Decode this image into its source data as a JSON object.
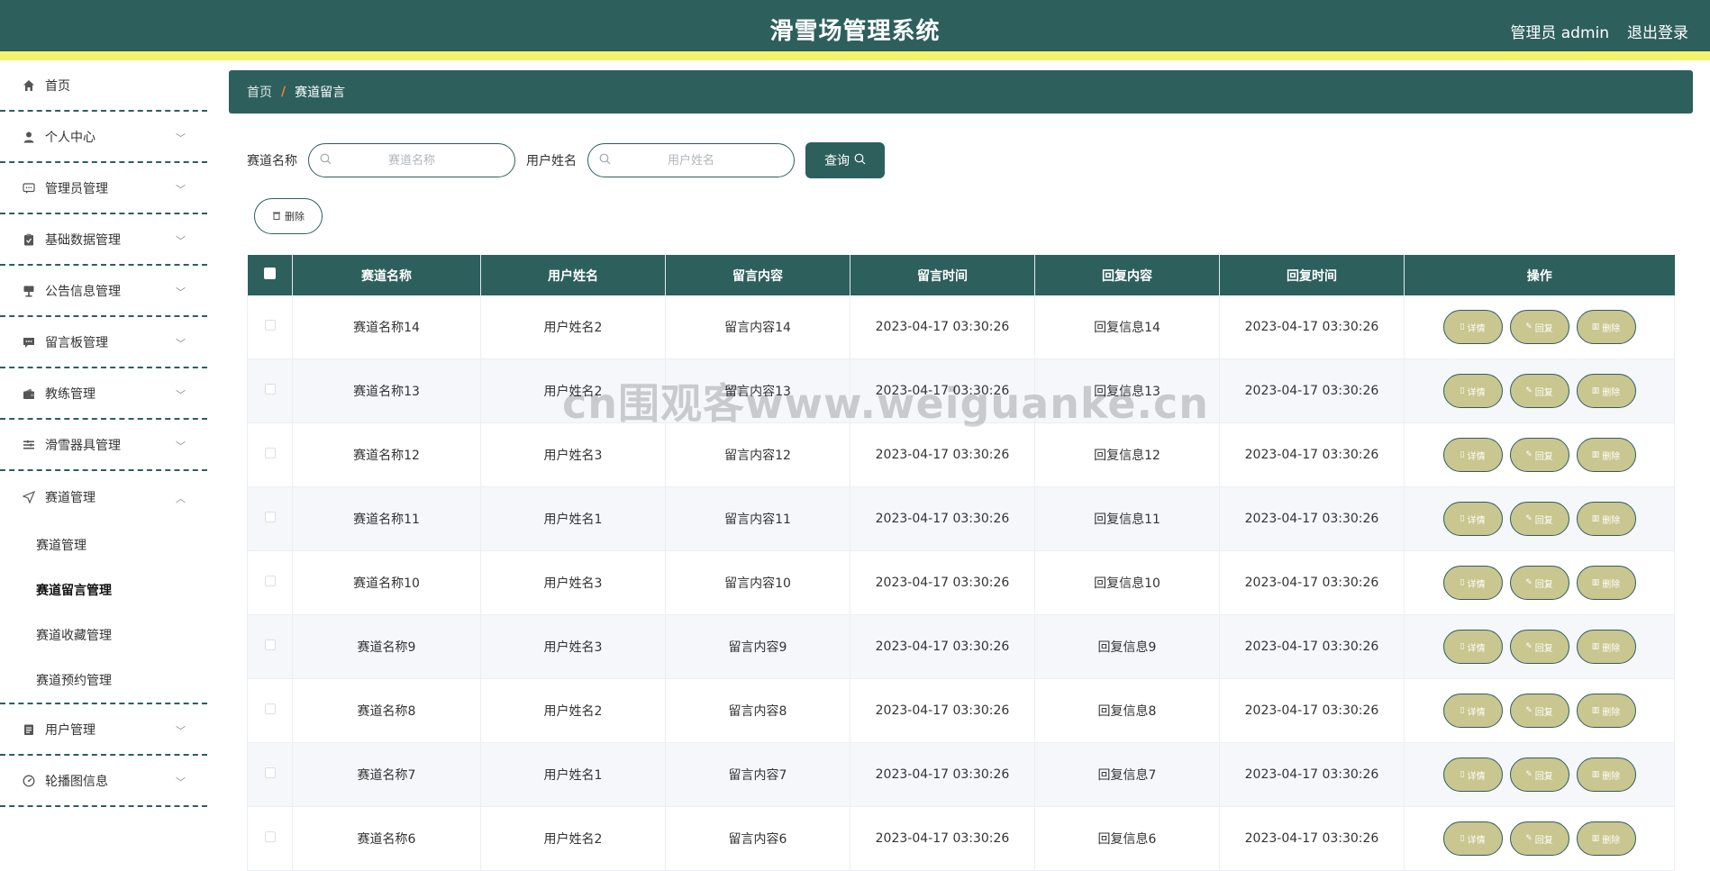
{
  "header": {
    "title": "滑雪场管理系统",
    "user_label": "管理员 admin",
    "logout_label": "退出登录"
  },
  "sidebar": {
    "items": [
      {
        "label": "首页",
        "icon": "home-icon"
      },
      {
        "label": "个人中心",
        "icon": "user-icon"
      },
      {
        "label": "管理员管理",
        "icon": "chat-icon"
      },
      {
        "label": "基础数据管理",
        "icon": "clipboard-icon"
      },
      {
        "label": "公告信息管理",
        "icon": "sign-icon"
      },
      {
        "label": "留言板管理",
        "icon": "message-icon"
      },
      {
        "label": "教练管理",
        "icon": "wallet-icon"
      },
      {
        "label": "滑雪器具管理",
        "icon": "list-icon"
      },
      {
        "label": "赛道管理",
        "icon": "send-icon"
      }
    ],
    "submenu": [
      {
        "label": "赛道管理"
      },
      {
        "label": "赛道留言管理"
      },
      {
        "label": "赛道收藏管理"
      },
      {
        "label": "赛道预约管理"
      }
    ],
    "items_after": [
      {
        "label": "用户管理",
        "icon": "doc-icon"
      },
      {
        "label": "轮播图信息",
        "icon": "gauge-icon"
      }
    ]
  },
  "breadcrumb": {
    "home": "首页",
    "sep": "/",
    "current": "赛道留言"
  },
  "search": {
    "track_label": "赛道名称",
    "track_placeholder": "赛道名称",
    "user_label": "用户姓名",
    "user_placeholder": "用户姓名",
    "query_label": "查询"
  },
  "toolbar": {
    "delete_label": "删除"
  },
  "table": {
    "columns": [
      "赛道名称",
      "用户姓名",
      "留言内容",
      "留言时间",
      "回复内容",
      "回复时间",
      "操作"
    ],
    "actions": {
      "detail": "详情",
      "reply": "回复",
      "delete": "删除"
    },
    "rows": [
      {
        "track": "赛道名称14",
        "user": "用户姓名2",
        "content": "留言内容14",
        "time": "2023-04-17 03:30:26",
        "reply": "回复信息14",
        "reply_time": "2023-04-17 03:30:26"
      },
      {
        "track": "赛道名称13",
        "user": "用户姓名2",
        "content": "留言内容13",
        "time": "2023-04-17 03:30:26",
        "reply": "回复信息13",
        "reply_time": "2023-04-17 03:30:26"
      },
      {
        "track": "赛道名称12",
        "user": "用户姓名3",
        "content": "留言内容12",
        "time": "2023-04-17 03:30:26",
        "reply": "回复信息12",
        "reply_time": "2023-04-17 03:30:26"
      },
      {
        "track": "赛道名称11",
        "user": "用户姓名1",
        "content": "留言内容11",
        "time": "2023-04-17 03:30:26",
        "reply": "回复信息11",
        "reply_time": "2023-04-17 03:30:26"
      },
      {
        "track": "赛道名称10",
        "user": "用户姓名3",
        "content": "留言内容10",
        "time": "2023-04-17 03:30:26",
        "reply": "回复信息10",
        "reply_time": "2023-04-17 03:30:26"
      },
      {
        "track": "赛道名称9",
        "user": "用户姓名3",
        "content": "留言内容9",
        "time": "2023-04-17 03:30:26",
        "reply": "回复信息9",
        "reply_time": "2023-04-17 03:30:26"
      },
      {
        "track": "赛道名称8",
        "user": "用户姓名2",
        "content": "留言内容8",
        "time": "2023-04-17 03:30:26",
        "reply": "回复信息8",
        "reply_time": "2023-04-17 03:30:26"
      },
      {
        "track": "赛道名称7",
        "user": "用户姓名1",
        "content": "留言内容7",
        "time": "2023-04-17 03:30:26",
        "reply": "回复信息7",
        "reply_time": "2023-04-17 03:30:26"
      },
      {
        "track": "赛道名称6",
        "user": "用户姓名2",
        "content": "留言内容6",
        "time": "2023-04-17 03:30:26",
        "reply": "回复信息6",
        "reply_time": "2023-04-17 03:30:26"
      }
    ]
  },
  "watermark": "cn围观客www.weiguanke.cn",
  "colors": {
    "primary": "#2d5f5d",
    "accent_bar": "#f5f36a",
    "action_button": "#c9c68f",
    "crumb_separator": "#ff7a3d"
  }
}
